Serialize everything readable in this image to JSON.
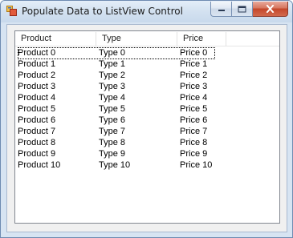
{
  "window": {
    "title": "Populate Data to ListView Control",
    "icon": "app-window-icon"
  },
  "listview": {
    "columns": [
      "Product",
      "Type",
      "Price"
    ],
    "rows": [
      [
        "Product 0",
        "Type 0",
        "Price 0"
      ],
      [
        "Product 1",
        "Type 1",
        "Price 1"
      ],
      [
        "Product 2",
        "Type 2",
        "Price 2"
      ],
      [
        "Product 3",
        "Type 3",
        "Price 3"
      ],
      [
        "Product 4",
        "Type 4",
        "Price 4"
      ],
      [
        "Product 5",
        "Type 5",
        "Price 5"
      ],
      [
        "Product 6",
        "Type 6",
        "Price 6"
      ],
      [
        "Product 7",
        "Type 7",
        "Price 7"
      ],
      [
        "Product 8",
        "Type 8",
        "Price 8"
      ],
      [
        "Product 9",
        "Type 9",
        "Price 9"
      ],
      [
        "Product 10",
        "Type 10",
        "Price 10"
      ]
    ]
  }
}
